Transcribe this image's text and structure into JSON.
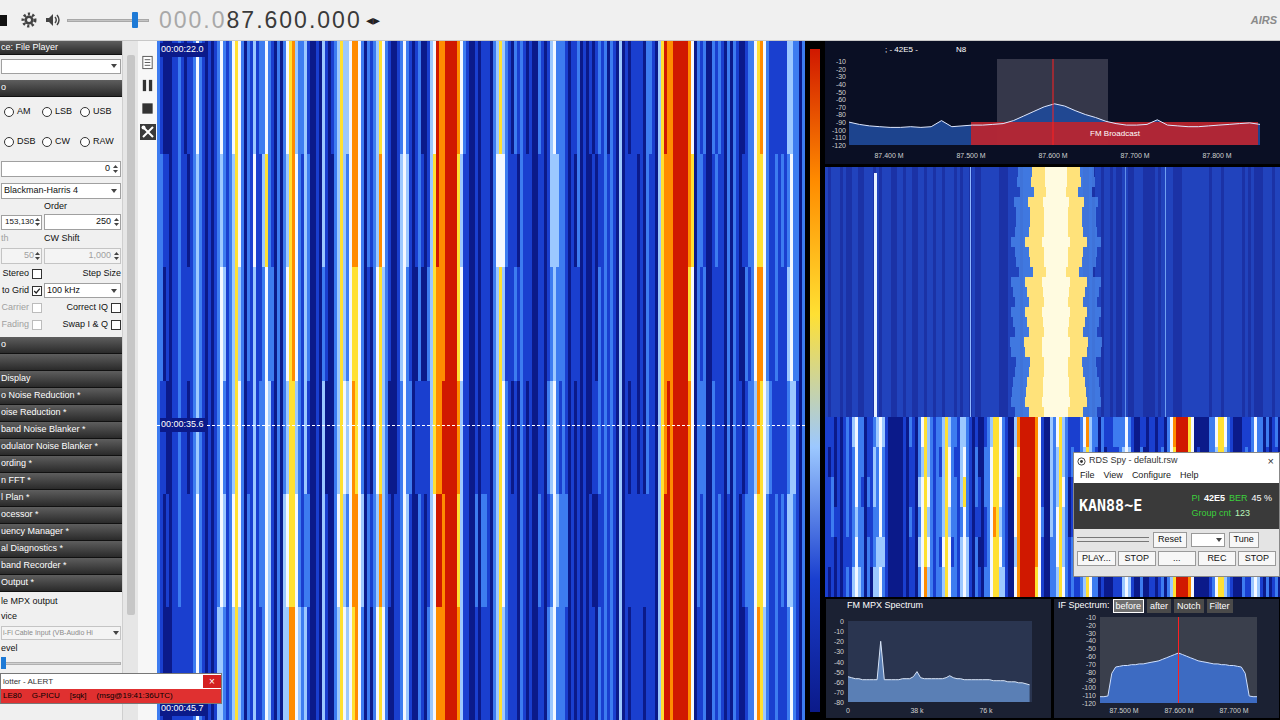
{
  "toolbar": {
    "frequency_dim": "000.0",
    "frequency": "87.600.000",
    "tuning_arrows": "◂▸",
    "logo": "AIRS",
    "volume_level": 0.85
  },
  "left_panel": {
    "source_header": "ce: File Player",
    "radio_header": "o",
    "modes": [
      {
        "label": "AM",
        "selected": false
      },
      {
        "label": "LSB",
        "selected": false
      },
      {
        "label": "USB",
        "selected": false
      },
      {
        "label": "DSB",
        "selected": false
      },
      {
        "label": "CW",
        "selected": false
      },
      {
        "label": "RAW",
        "selected": false
      }
    ],
    "shift": "0",
    "window": "Blackman-Harris 4",
    "order_label": "Order",
    "filter_bandwidth": "153,130",
    "order": "250",
    "squelch_label": "th",
    "cw_shift_label": "CW Shift",
    "squelch": {
      "value": "50",
      "disabled": true
    },
    "cw_shift": {
      "value": "1,000",
      "disabled": true
    },
    "options": [
      {
        "left": {
          "kind": "checkbox",
          "label": "Stereo",
          "checked": false,
          "disabled": false
        },
        "right": {
          "kind": "label",
          "label": "Step Size"
        }
      },
      {
        "left": {
          "kind": "checkbox",
          "label": "to Grid",
          "checked": true,
          "disabled": false
        },
        "right": {
          "kind": "dropdown",
          "value": "100 kHz"
        }
      },
      {
        "left": {
          "kind": "checkbox",
          "label": "Carrier",
          "checked": false,
          "disabled": true
        },
        "right": {
          "kind": "checkbox",
          "label": "Correct IQ",
          "checked": false,
          "disabled": false
        }
      },
      {
        "left": {
          "kind": "checkbox",
          "label": "Fading",
          "checked": false,
          "disabled": true
        },
        "right": {
          "kind": "checkbox",
          "label": "Swap I & Q",
          "checked": false,
          "disabled": false
        }
      }
    ],
    "sections": [
      "o",
      "Display",
      "o Noise Reduction *",
      "oise Reduction *",
      "band Noise Blanker *",
      "odulator Noise Blanker *",
      "ording *",
      "n FFT *",
      "l Plan *",
      "ocessor *",
      "uency Manager *",
      "al Diagnostics *",
      "band Recorder *",
      "Output *"
    ],
    "mpx_label": "le MPX output",
    "device_label": "vice",
    "device": "i-Fi Cable Input (VB-Audio Hi",
    "level_label": "evel",
    "level": 0.0
  },
  "plotter": {
    "title": "lotter - ALERT",
    "close": "×",
    "message": [
      "LE80",
      "G-PICU",
      "[sqk]",
      "(msg@19:41:36UTC)"
    ]
  },
  "waterfall": {
    "timestamps": [
      {
        "label": "00:00:22.0",
        "marker": false
      },
      {
        "label": "00:00:35.6",
        "marker": true
      },
      {
        "label": "00:00:45.7",
        "marker": false
      }
    ]
  },
  "spectrum": {
    "title": "; - 42E5 -",
    "mode": "N8",
    "y_ticks": [
      "-10",
      "-20",
      "-30",
      "-40",
      "-50",
      "-60",
      "-70",
      "-80",
      "-90",
      "-100",
      "-110",
      "-120"
    ],
    "x_ticks": [
      "87.400 M",
      "87.500 M",
      "87.600 M",
      "87.700 M",
      "87.800 M"
    ],
    "band": "FM Broadcast",
    "values": [
      -90,
      -93,
      -95,
      -96,
      -97,
      -97,
      -96,
      -97,
      -96,
      -88,
      -96,
      -95,
      -94,
      -94,
      -93,
      -92,
      -88,
      -82,
      -76,
      -70,
      -66,
      -69,
      -75,
      -80,
      -84,
      -89,
      -92,
      -94,
      -94,
      -93,
      -87,
      -94,
      -95,
      -96,
      -96,
      -95,
      -94,
      -93,
      -92,
      -91,
      -93
    ]
  },
  "rds_spy": {
    "title": "RDS Spy - default.rsw",
    "close": "×",
    "menu": [
      "File",
      "View",
      "Configure",
      "Help"
    ],
    "ps": "KAN88~E",
    "pi_label": "PI",
    "pi": "42E5",
    "ber_label": "BER",
    "ber": "45 %",
    "group_label": "Group cnt",
    "group_count": "123",
    "buttons_row1": [
      "Reset",
      "Tune"
    ],
    "buttons_row2": [
      "PLAY...",
      "STOP",
      "...",
      "REC",
      "STOP"
    ]
  },
  "mpx": {
    "title": "FM MPX Spectrum",
    "y_ticks": [
      "0",
      "-10",
      "-20",
      "-30",
      "-40",
      "-50",
      "-60",
      "-70",
      "-80"
    ],
    "x_ticks": [
      "0",
      "38 k",
      "76 k"
    ],
    "values": [
      -55,
      -56,
      -57,
      -57,
      -58,
      -58,
      -58,
      -58,
      -58,
      -20,
      -58,
      -58,
      -58,
      -58,
      -58,
      -57,
      -57,
      -57,
      -55,
      -50,
      -56,
      -57,
      -57,
      -57,
      -57,
      -57,
      -57,
      -56,
      -54,
      -56,
      -57,
      -57,
      -58,
      -58,
      -58,
      -58,
      -58,
      -58,
      -58,
      -58,
      -59,
      -59,
      -59,
      -59,
      -60,
      -60,
      -60,
      -61,
      -61,
      -62,
      -63
    ]
  },
  "if_spectrum": {
    "title": "IF Spectrum:",
    "buttons": [
      {
        "label": "before",
        "selected": true
      },
      {
        "label": "after",
        "selected": false
      },
      {
        "label": "Notch",
        "selected": false
      },
      {
        "label": "Filter",
        "selected": false
      }
    ],
    "y_ticks": [
      "-10",
      "-20",
      "-30",
      "-40",
      "-50",
      "-60",
      "-70",
      "-80",
      "-90",
      "-100",
      "-110",
      "-120"
    ],
    "x_ticks": [
      "87.500 M",
      "87.600 M",
      "87.700 M"
    ],
    "values": [
      -112,
      -112,
      -111,
      -82,
      -74,
      -73,
      -72,
      -72,
      -71,
      -71,
      -70,
      -70,
      -69,
      -68,
      -67,
      -66,
      -64,
      -62,
      -60,
      -58,
      -56,
      -58,
      -60,
      -62,
      -64,
      -66,
      -67,
      -68,
      -69,
      -70,
      -70,
      -71,
      -71,
      -72,
      -72,
      -73,
      -74,
      -82,
      -111,
      -112,
      -112
    ]
  }
}
